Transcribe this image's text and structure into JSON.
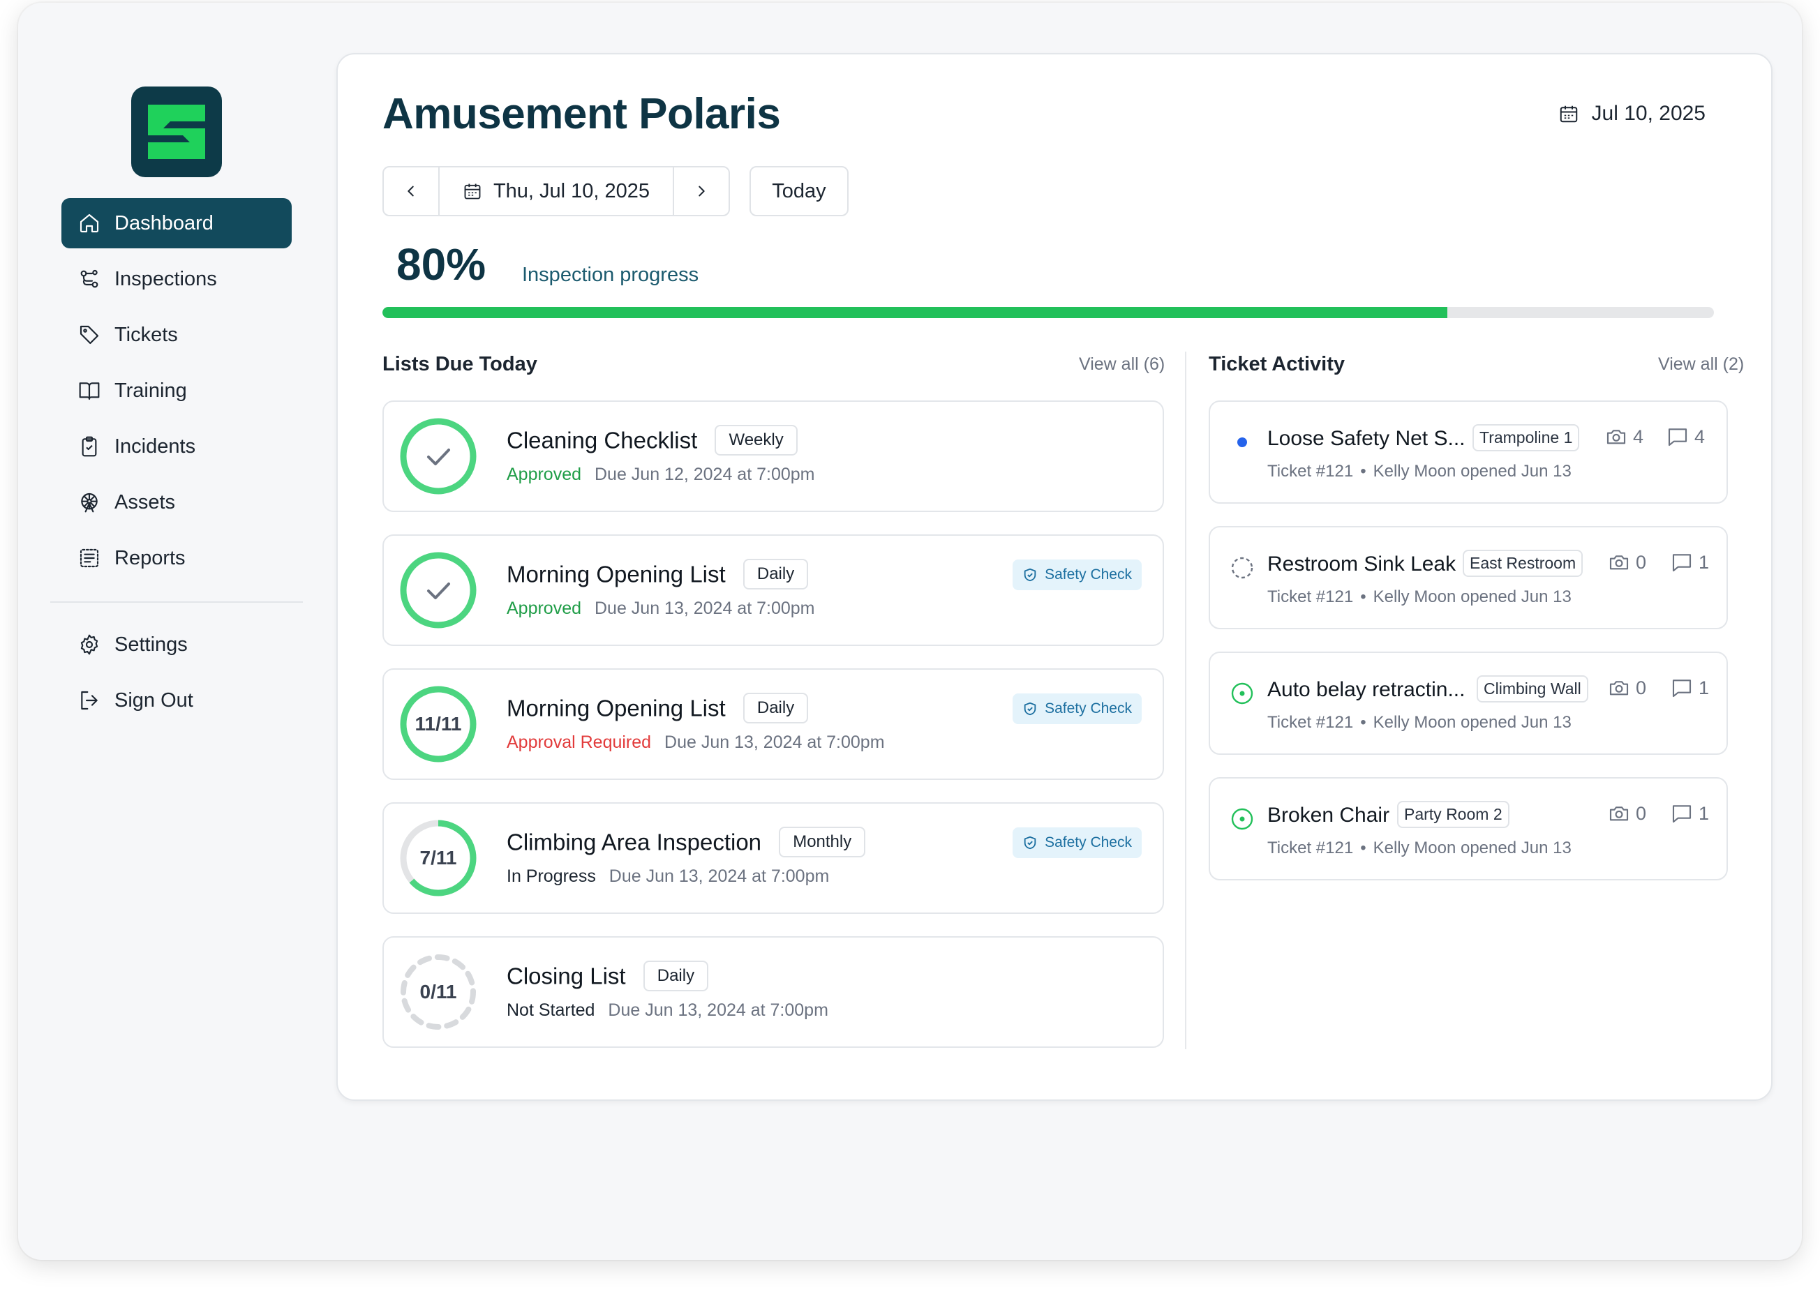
{
  "sidebar": {
    "nav": [
      {
        "label": "Dashboard",
        "icon": "home-icon",
        "active": true
      },
      {
        "label": "Inspections",
        "icon": "route-icon"
      },
      {
        "label": "Tickets",
        "icon": "tag-icon"
      },
      {
        "label": "Training",
        "icon": "book-icon"
      },
      {
        "label": "Incidents",
        "icon": "clipboard-icon"
      },
      {
        "label": "Assets",
        "icon": "ferris-wheel-icon"
      },
      {
        "label": "Reports",
        "icon": "report-icon"
      }
    ],
    "bottom": [
      {
        "label": "Settings",
        "icon": "gear-icon"
      },
      {
        "label": "Sign Out",
        "icon": "logout-icon"
      }
    ]
  },
  "header": {
    "title": "Amusement Polaris",
    "date": "Jul 10, 2025"
  },
  "date_nav": {
    "current": "Thu, Jul 10, 2025",
    "today_label": "Today"
  },
  "progress": {
    "percent_label": "80%",
    "label": "Inspection progress",
    "value": 0.8
  },
  "lists": {
    "title": "Lists Due Today",
    "view_all": "View all (6)",
    "items": [
      {
        "title": "Cleaning Checklist",
        "frequency": "Weekly",
        "status": "Approved",
        "due": "Due Jun 12, 2024 at 7:00pm",
        "progress_text": "",
        "state": "done",
        "safety": ""
      },
      {
        "title": "Morning Opening List",
        "frequency": "Daily",
        "status": "Approved",
        "due": "Due Jun 13, 2024 at 7:00pm",
        "progress_text": "",
        "state": "done",
        "safety": "Safety Check"
      },
      {
        "title": "Morning Opening List",
        "frequency": "Daily",
        "status": "Approval Required",
        "due": "Due Jun 13, 2024 at 7:00pm",
        "progress_text": "11/11",
        "state": "full",
        "safety": "Safety Check"
      },
      {
        "title": "Climbing Area Inspection",
        "frequency": "Monthly",
        "status": "In Progress",
        "due": "Due Jun 13, 2024 at 7:00pm",
        "progress_text": "7/11",
        "state": "partial",
        "safety": "Safety Check"
      },
      {
        "title": "Closing List",
        "frequency": "Daily",
        "status": "Not Started",
        "due": "Due Jun 13, 2024 at 7:00pm",
        "progress_text": "0/11",
        "state": "empty",
        "safety": ""
      }
    ]
  },
  "tickets": {
    "title": "Ticket Activity",
    "view_all": "View all (2)",
    "items": [
      {
        "title": "Loose Safety Net S...",
        "tag": "Trampoline 1",
        "photos": "4",
        "comments": "4",
        "ticket": "Ticket #121",
        "opened": "Kelly Moon opened Jun 13",
        "status": "new"
      },
      {
        "title": "Restroom Sink Leak",
        "tag": "East Restroom",
        "photos": "0",
        "comments": "1",
        "ticket": "Ticket #121",
        "opened": "Kelly Moon opened Jun 13",
        "status": "pending"
      },
      {
        "title": "Auto belay retractin...",
        "tag": "Climbing Wall",
        "photos": "0",
        "comments": "1",
        "ticket": "Ticket #121",
        "opened": "Kelly Moon opened Jun 13",
        "status": "open"
      },
      {
        "title": "Broken Chair",
        "tag": "Party Room 2",
        "photos": "0",
        "comments": "1",
        "ticket": "Ticket #121",
        "opened": "Kelly Moon opened Jun 13",
        "status": "open"
      }
    ]
  },
  "colors": {
    "brand_dark": "#0d3a48",
    "brand_green": "#1fd15b",
    "active_nav": "#124a5c",
    "progress_green": "#22c05a",
    "ring_green": "#4cd580",
    "approved_text": "#1f9d47",
    "required_text": "#e23b3b",
    "ticket_new_dot": "#2563eb"
  }
}
